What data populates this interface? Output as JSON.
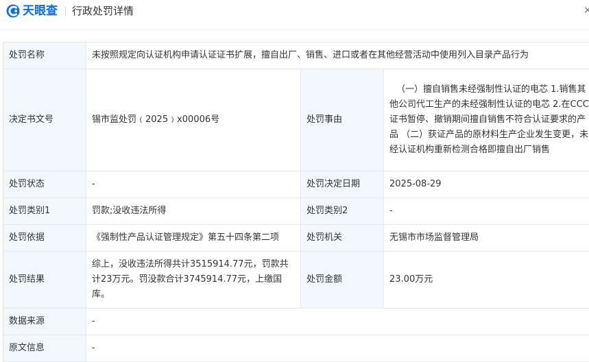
{
  "header": {
    "logo_text": "天眼查",
    "page_title": "行政处罚详情",
    "close_glyph": "×"
  },
  "colors": {
    "brand": "#0a6ee8",
    "label_bg": "#f2f7fe",
    "border": "#e8e8e8"
  },
  "rows": {
    "penalty_name": {
      "label": "处罚名称",
      "value": "未按照规定向认证机构申请认证证书扩展，擅自出厂、销售、进口或者在其他经营活动中使用列入目录产品行为"
    },
    "decision_no": {
      "label": "决定书文号",
      "value": "锡市监处罚﹙2025﹚x00006号"
    },
    "reason": {
      "label": "处罚事由",
      "value": "（一）擅自销售未经强制性认证的电芯 1.销售其他公司代工生产的未经强制性认证的电芯 2.在CCC证书暂停、撤销期间擅自销售不符合认证要求的产品 （二）获证产品的原材料生产企业发生变更，未经认证机构重新检测合格即擅自出厂销售"
    },
    "status": {
      "label": "处罚状态",
      "value": "-"
    },
    "decision_date": {
      "label": "处罚决定日期",
      "value": "2025-08-29"
    },
    "category1": {
      "label": "处罚类别1",
      "value": "罚款;没收违法所得"
    },
    "category2": {
      "label": "处罚类别2",
      "value": "-"
    },
    "basis": {
      "label": "处罚依据",
      "value": "《强制性产品认证管理规定》第五十四条第二项"
    },
    "authority": {
      "label": "处罚机关",
      "value": "无锡市市场监督管理局"
    },
    "result": {
      "label": "处罚结果",
      "value": "综上，没收违法所得共计3515914.77元，罚款共计23万元。罚没款合计3745914.77元，上缴国库。"
    },
    "amount": {
      "label": "处罚金额",
      "value": "23.00万元"
    },
    "data_source": {
      "label": "数据来源",
      "value": "-"
    },
    "original_info": {
      "label": "原文信息",
      "value": "-"
    }
  }
}
